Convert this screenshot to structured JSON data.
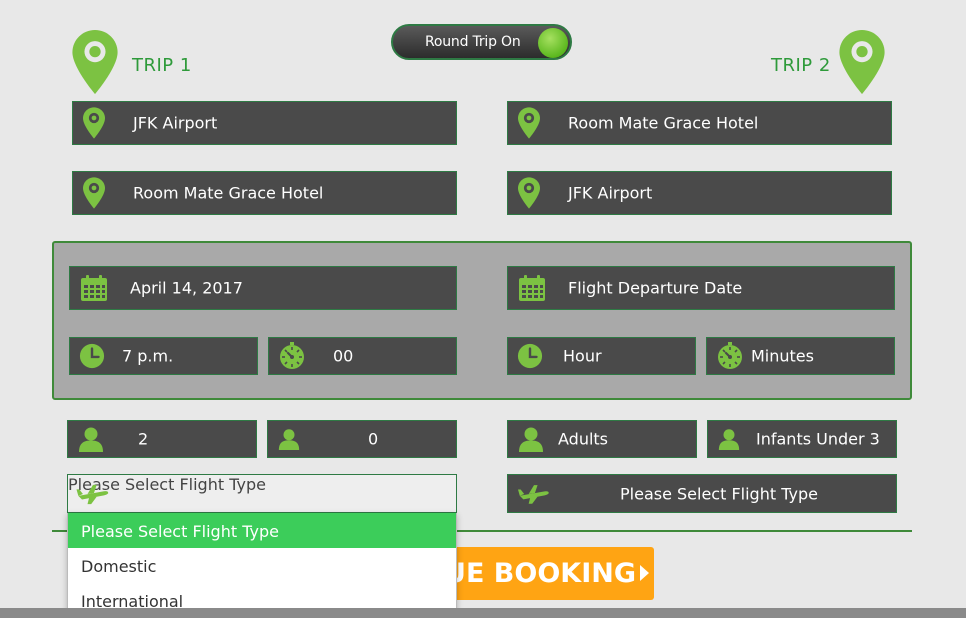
{
  "toggle": {
    "label": "Round Trip On",
    "on": true
  },
  "trip1": {
    "title": "TRIP 1",
    "from": "JFK Airport",
    "to": "Room Mate Grace Hotel",
    "date": "April 14, 2017",
    "hour": "7 p.m.",
    "minutes": "00",
    "adults": "2",
    "infants": "0",
    "flight_type": "Please Select Flight Type"
  },
  "trip2": {
    "title": "TRIP 2",
    "from": "Room Mate Grace Hotel",
    "to": "JFK Airport",
    "date_placeholder": "Flight Departure Date",
    "hour_placeholder": "Hour",
    "minutes_placeholder": "Minutes",
    "adults_placeholder": "Adults",
    "infants_placeholder": "Infants Under 3",
    "flight_type": "Please Select Flight Type"
  },
  "flight_type_options": [
    "Please Select Flight Type",
    "Domestic",
    "International"
  ],
  "continue_button": "UE BOOKING",
  "colors": {
    "accent_green": "#7cc242",
    "field_bg": "#4a4a4a",
    "button_orange": "#ffa413",
    "selected_option": "#3ccd5a"
  },
  "icons": [
    "map-pin-icon",
    "calendar-icon",
    "clock-icon",
    "stopwatch-icon",
    "person-icon",
    "airplane-icon"
  ]
}
